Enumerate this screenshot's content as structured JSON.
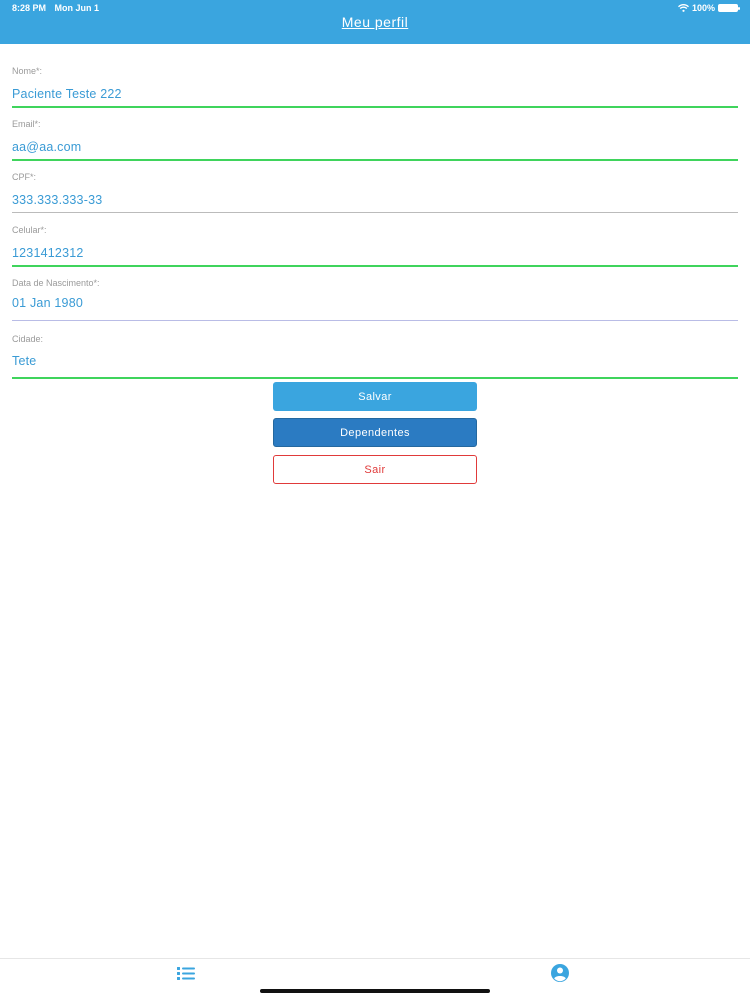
{
  "status_bar": {
    "time": "8:28 PM",
    "date": "Mon Jun 1",
    "battery": "100%"
  },
  "header": {
    "title": "Meu perfil"
  },
  "form": {
    "name": {
      "label": "Nome*:",
      "value": "Paciente Teste 222"
    },
    "email": {
      "label": "Email*:",
      "value": "aa@aa.com"
    },
    "cpf": {
      "label": "CPF*:",
      "value": "333.333.333-33"
    },
    "phone": {
      "label": "Celular*:",
      "value": "1231412312"
    },
    "birthdate": {
      "label": "Data de Nascimento*:",
      "value": "01 Jan 1980"
    },
    "city": {
      "label": "Cidade:",
      "value": "Tete"
    }
  },
  "buttons": {
    "save": "Salvar",
    "dependents": "Dependentes",
    "exit": "Sair"
  },
  "tabbar": {
    "icons": [
      "list-icon",
      "profile-icon"
    ]
  },
  "colors": {
    "header": "#3aa5df",
    "field_value": "#3a9bd5",
    "active_underline": "#3fd45c",
    "dependents_button": "#2b7bc2",
    "exit_button": "#e03a3a"
  }
}
